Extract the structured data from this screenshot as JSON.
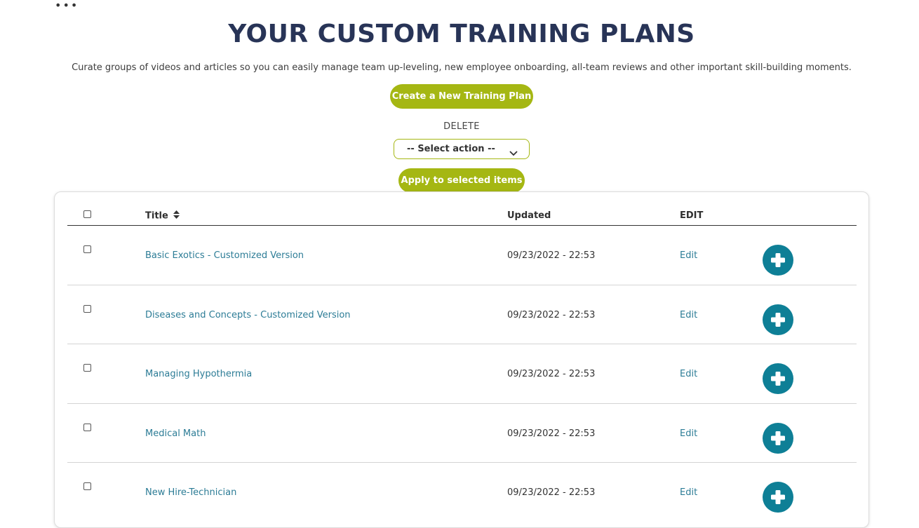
{
  "header": {
    "menu_dots": "•••",
    "title": "YOUR CUSTOM TRAINING PLANS",
    "subtitle": "Curate groups of videos and articles so you can easily manage team up-leveling, new employee onboarding, all-team reviews and other important skill-building moments."
  },
  "actions": {
    "create_label": "Create a New Training Plan",
    "bulk_label": "DELETE",
    "select_value": "-- Select action --",
    "apply_label": "Apply to selected items"
  },
  "table": {
    "columns": {
      "title": "Title",
      "updated": "Updated",
      "edit": "EDIT"
    },
    "rows": [
      {
        "title": "Basic Exotics - Customized Version",
        "updated": "09/23/2022 - 22:53",
        "edit": "Edit"
      },
      {
        "title": "Diseases and Concepts - Customized Version",
        "updated": "09/23/2022 - 22:53",
        "edit": "Edit"
      },
      {
        "title": "Managing Hypothermia",
        "updated": "09/23/2022 - 22:53",
        "edit": "Edit"
      },
      {
        "title": "Medical Math",
        "updated": "09/23/2022 - 22:53",
        "edit": "Edit"
      },
      {
        "title": "New Hire-Technician",
        "updated": "09/23/2022 - 22:53",
        "edit": "Edit"
      }
    ]
  },
  "colors": {
    "heading": "#283457",
    "accent_green": "#a5b713",
    "link_teal": "#2c7c96",
    "plus_teal": "#0e7f96"
  },
  "icons": {
    "menu": "more-dots-icon",
    "dropdown": "chevron-down-icon",
    "sort": "sort-icon",
    "add": "plus-icon"
  }
}
